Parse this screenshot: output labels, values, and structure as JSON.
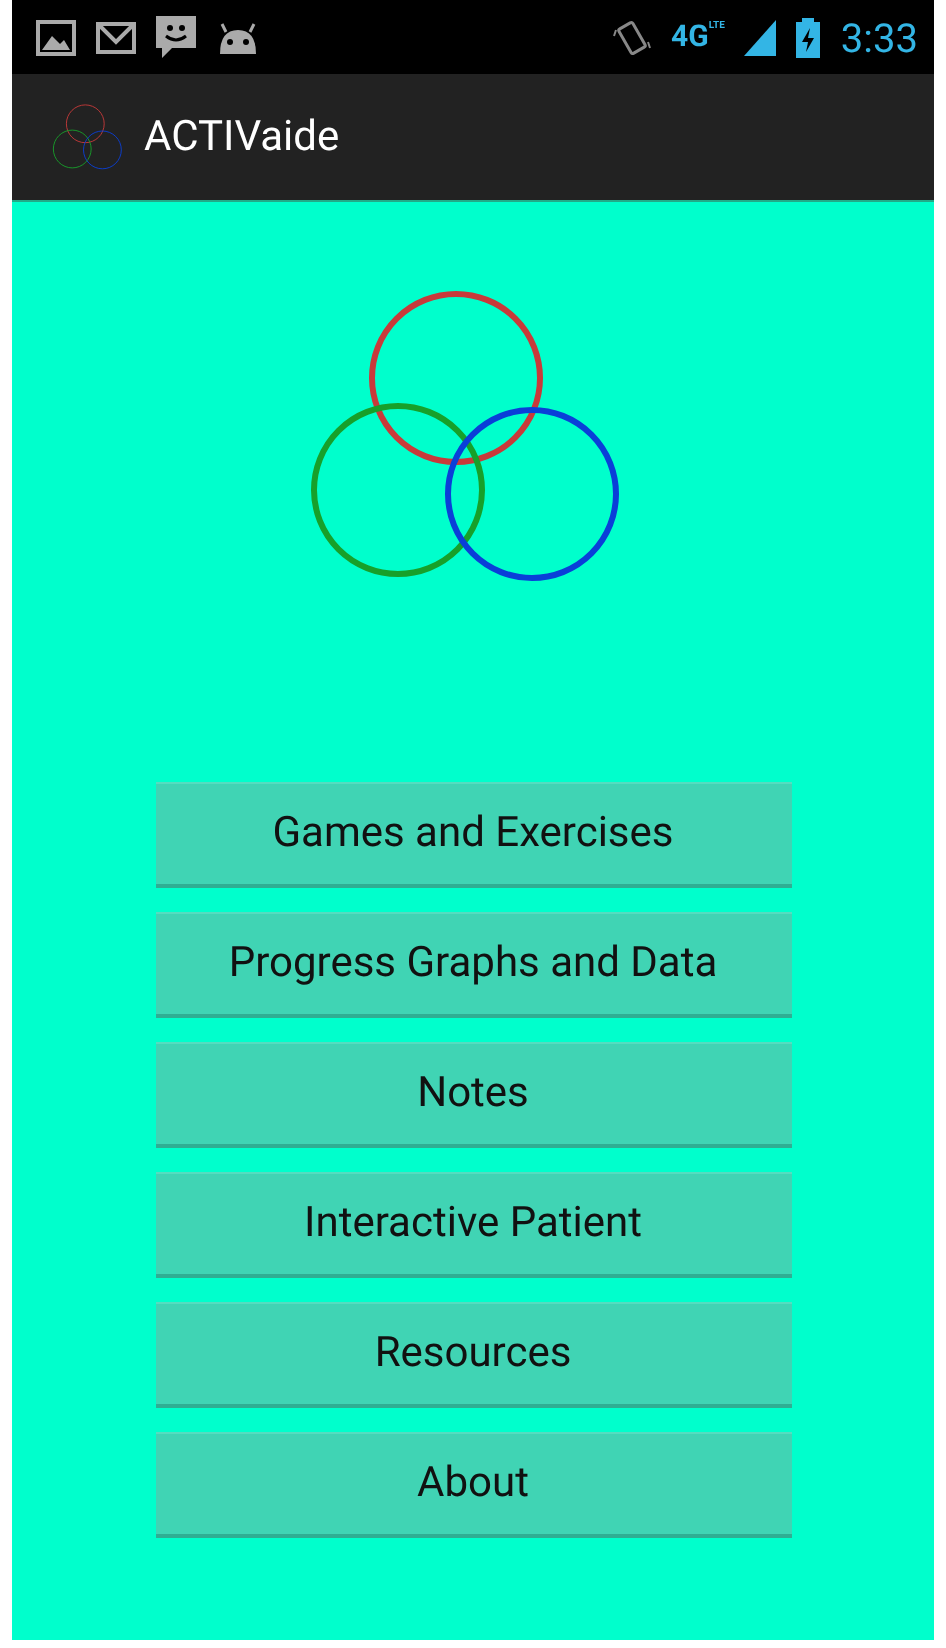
{
  "status_bar": {
    "network": "4G",
    "network_sub": "LTE",
    "time": "3:33"
  },
  "action_bar": {
    "title": "ACTIVaide"
  },
  "menu": [
    {
      "label": "Games and Exercises"
    },
    {
      "label": "Progress Graphs and Data"
    },
    {
      "label": "Notes"
    },
    {
      "label": "Interactive Patient"
    },
    {
      "label": "Resources"
    },
    {
      "label": "About"
    }
  ]
}
